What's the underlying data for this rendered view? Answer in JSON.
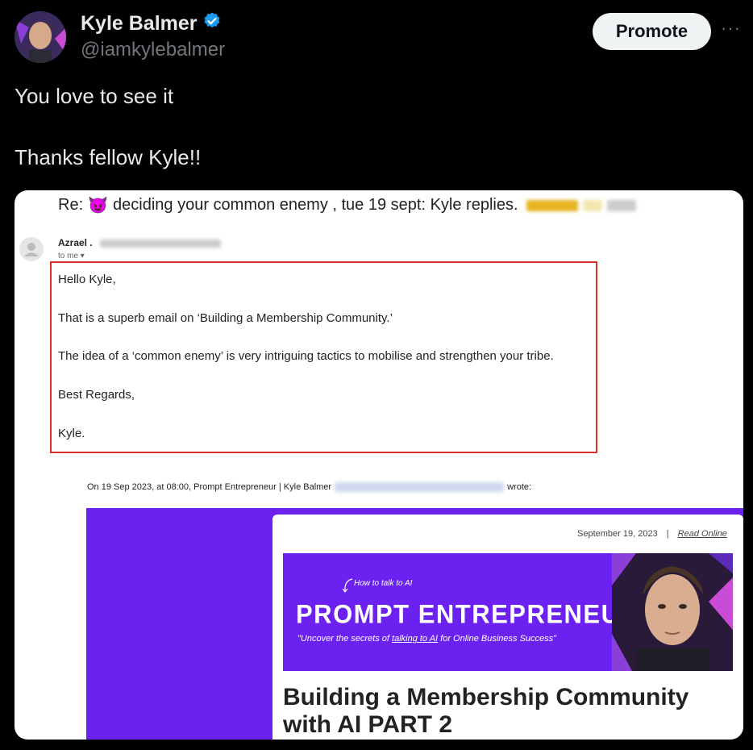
{
  "author": {
    "name": "Kyle Balmer",
    "handle": "@iamkylebalmer",
    "verified": true
  },
  "actions": {
    "promote_label": "Promote",
    "more_label": "···"
  },
  "tweet": {
    "line1": "You love to see it",
    "line2": "Thanks fellow Kyle!!"
  },
  "email": {
    "subject_prefix": "Re:",
    "subject_emoji": "😈",
    "subject_text": "deciding your common enemy , tue 19 sept: Kyle replies.",
    "sender_name": "Azrael .",
    "to_me": "to me ▾",
    "body": [
      "Hello Kyle,",
      "That is a superb email on ‘Building a Membership Community.’",
      "The idea of a ‘common enemy’ is very intriguing tactics to mobilise and strengthen your tribe.",
      "Best Regards,",
      "Kyle."
    ],
    "quote_prefix": "On 19 Sep 2023, at 08:00, Prompt Entrepreneur | Kyle Balmer",
    "quote_suffix": "wrote:"
  },
  "newsletter": {
    "date": "September 19, 2023",
    "separator": "|",
    "read_online": "Read Online",
    "how_to": "How to talk to AI",
    "brand": "PROMPT ENTREPRENEUR",
    "tagline_pre": "\"Uncover the secrets of ",
    "tagline_link": "talking to AI",
    "tagline_post": " for Online Business Success\"",
    "headline": "Building a Membership Community with AI PART 2"
  },
  "colors": {
    "background": "#000000",
    "verified_badge": "#1d9bf0",
    "highlight_box": "#d9322a",
    "brand_purple": "#6b21f0"
  }
}
